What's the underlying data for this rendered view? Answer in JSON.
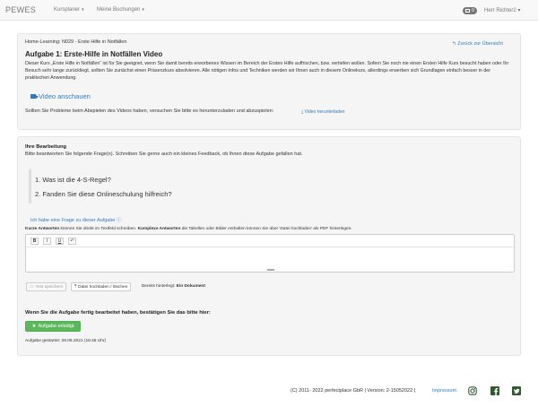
{
  "navbar": {
    "brand": "PEWES",
    "menus": [
      "Kursplaner",
      "Meine Buchungen"
    ],
    "mail_count": "0",
    "user": "Herr Richter2"
  },
  "task": {
    "breadcrumb": "Home-Learning: N029 - Erste Hilfe in Notfällen",
    "back_link": "Zurück zur Übersicht",
    "title": "Aufgabe 1: Erste-Hilfe in Notfällen Video",
    "description": "Dieser Kurs „Erste Hilfe in Notfällen“ ist für Sie geeignet, wenn Sie damit bereits erworbenes Wissen im Bereich der Ersten Hilfe auffrischen, bzw. vertiefen wollen. Sofern Sie noch nie einen Ersten Hilfe Kurs besucht haben oder Ihr Besuch sehr lange zurückliegt, sollten Sie zunächst einen Präsenzkurs absolvieren. Alle nötigen Infos und Techniken werden wir Ihnen auch in diesem Onlinekurs, allerdings erwerben sich Grundlagen einfach besser in der praktischen Anwendung.",
    "video_link": "Video anschauen",
    "problem_text": "Sollten Sie Probleme beim Abspielen des Videos haben, versuchen Sie bitte es herunterzuladen und abzuspielen:",
    "download_link": "Video herunterladen"
  },
  "work": {
    "heading": "Ihre Bearbeitung",
    "subheading": "Bitte beantworten Sie folgende Frage(n). Schreiben Sie gerne auch ein kleines Feedback, ob Ihnen diese Aufgabe gefallen hat.",
    "questions": [
      "1. Was ist die 4-S-Regel?",
      "2. Fanden Sie diese Onlineschulung hilfreich?"
    ],
    "question_help": "Ich habe eine Frage zu dieser Aufgabe",
    "short_label": "Kurze Antworten",
    "short_text": " können Sie direkt im Textfeld schreiben. ",
    "long_label": "Komplexe Antworten",
    "long_text": " die Tabellen oder Bilder enthalten können Sie über 'Datei hochladen' als PDF hinterlegen.",
    "toolbar": [
      "B",
      "I",
      "U",
      "↶"
    ],
    "save_button": "Text speichern",
    "upload_button": "Datei hochladen / löschen",
    "uploaded_label": "Bereits hinterlegt: ",
    "uploaded_value": "Ein Dokument",
    "confirm_text": "Wenn Sie die Aufgabe fertig bearbeitet haben, bestätigen Sie das bitte hier:",
    "done_button": "Aufgabe erledigt",
    "started": "Aufgabe gestartet: 28.06.2021 (16:45 Uhr)"
  },
  "footer": {
    "copyright": "(C) 2011- 2022 perfectplace GbR | Version: 2-15052022 |",
    "impressum": "Impressum",
    "social_icons": [
      "instagram-icon",
      "facebook-icon",
      "twitter-icon"
    ],
    "social_color": "#2e5a2e"
  }
}
